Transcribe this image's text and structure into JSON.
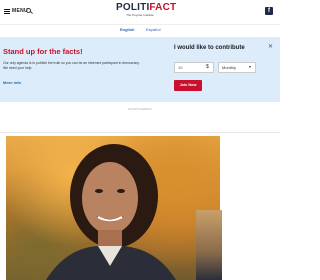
{
  "header": {
    "menu_label": "MENU",
    "logo_part1": "POLITI",
    "logo_part2": "FACT",
    "tagline": "The Poynter Institute"
  },
  "languages": [
    {
      "label": "English",
      "selected": true
    },
    {
      "label": "Español",
      "selected": false
    }
  ],
  "banner": {
    "title": "Stand up for the facts!",
    "text": "Our only agenda is to publish the truth so you can be an informed participant in democracy. We need your help.",
    "more_info": "More info",
    "contribute_title": "I would like to contribute",
    "amount_value": "10",
    "amount_symbol": "$",
    "frequency": "Monthly",
    "join_label": "Join Now"
  },
  "ad_label": "ADVERTISEMENT",
  "colors": {
    "brand_red": "#c8102e",
    "brand_navy": "#1f2a44",
    "banner_bg": "#dcecfb",
    "link_blue": "#2a63b8"
  }
}
